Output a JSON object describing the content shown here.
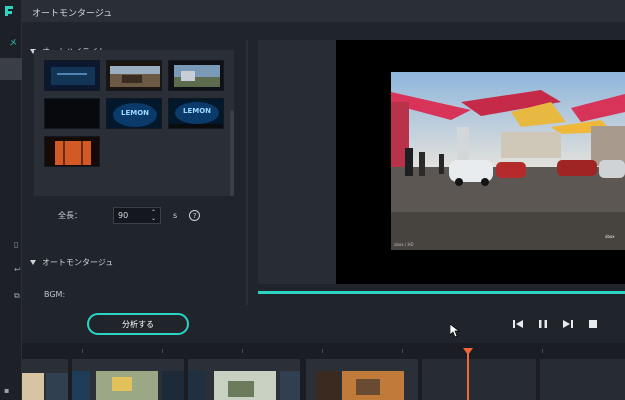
{
  "app": {
    "nav_label": "メ"
  },
  "dialog": {
    "title": "オートモンタージュ"
  },
  "auto_highlight": {
    "heading": "オートハイライト",
    "thumbnails": [
      {
        "label": ""
      },
      {
        "label": ""
      },
      {
        "label": ""
      },
      {
        "label": ""
      },
      {
        "label": "LEMON"
      },
      {
        "label": "LEMON"
      },
      {
        "label": ""
      }
    ]
  },
  "length": {
    "label": "全長：",
    "value": "90",
    "unit": "s",
    "help": "?"
  },
  "auto_montage": {
    "heading": "オートモンタージュ",
    "bgm_label": "BGM:"
  },
  "analyze_button": {
    "label": "分析する"
  },
  "colors": {
    "accent": "#2bd3c2",
    "playhead": "#f0663a"
  },
  "icons": {
    "prev": "skip-back-icon",
    "pause": "pause-icon",
    "next": "skip-forward-icon",
    "stop": "stop-icon"
  }
}
